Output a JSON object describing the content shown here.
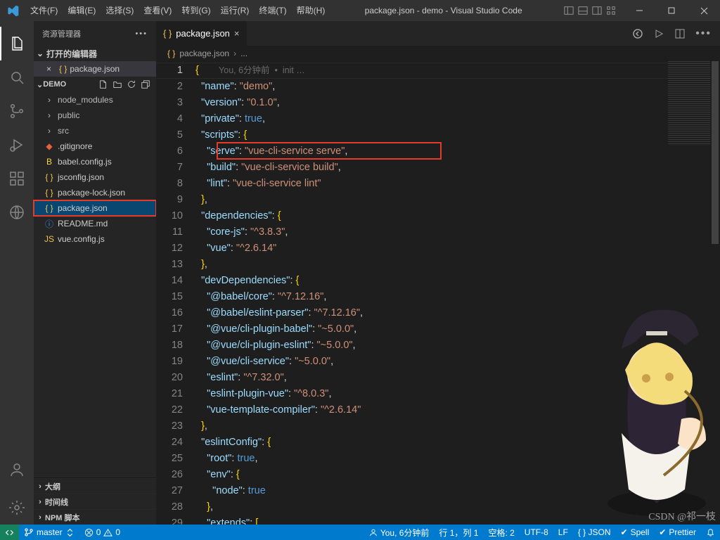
{
  "menu": [
    "文件(F)",
    "编辑(E)",
    "选择(S)",
    "查看(V)",
    "转到(G)",
    "运行(R)",
    "终端(T)",
    "帮助(H)"
  ],
  "window_title": "package.json - demo - Visual Studio Code",
  "sidebar": {
    "header": "资源管理器",
    "open_editors": {
      "label": "打开的编辑器",
      "file": "package.json"
    },
    "demo_label": "DEMO",
    "tree": [
      {
        "kind": "folder",
        "name": "node_modules"
      },
      {
        "kind": "folder",
        "name": "public"
      },
      {
        "kind": "folder",
        "name": "src"
      },
      {
        "kind": "file",
        "icon": "git",
        "name": ".gitignore"
      },
      {
        "kind": "file",
        "icon": "babel",
        "name": "babel.config.js"
      },
      {
        "kind": "file",
        "icon": "json",
        "name": "jsconfig.json"
      },
      {
        "kind": "file",
        "icon": "json",
        "name": "package-lock.json"
      },
      {
        "kind": "file",
        "icon": "json",
        "name": "package.json",
        "selected": true
      },
      {
        "kind": "file",
        "icon": "info",
        "name": "README.md"
      },
      {
        "kind": "file",
        "icon": "js",
        "name": "vue.config.js"
      }
    ],
    "collapsed": [
      "大纲",
      "时间线",
      "NPM 脚本"
    ]
  },
  "tab": {
    "name": "package.json"
  },
  "breadcrumb": [
    "package.json",
    "..."
  ],
  "code_lens": {
    "author": "You,",
    "time": "6分钟前",
    "sep": "•",
    "msg": "init …"
  },
  "code_lines": [
    {
      "n": 1
    },
    {
      "n": 2,
      "key": "name",
      "val": "demo",
      "t": "s",
      "comma": true
    },
    {
      "n": 3,
      "key": "version",
      "val": "0.1.0",
      "t": "s",
      "comma": true
    },
    {
      "n": 4,
      "key": "private",
      "val": "true",
      "t": "b",
      "comma": true
    },
    {
      "n": 5,
      "key": "scripts",
      "open": true
    },
    {
      "n": 6,
      "key": "serve",
      "val": "vue-cli-service serve",
      "t": "s",
      "comma": true,
      "ind": 2,
      "hl": true
    },
    {
      "n": 7,
      "key": "build",
      "val": "vue-cli-service build",
      "t": "s",
      "comma": true,
      "ind": 2
    },
    {
      "n": 8,
      "key": "lint",
      "val": "vue-cli-service lint",
      "t": "s",
      "ind": 2
    },
    {
      "n": 9,
      "close": true,
      "comma": true
    },
    {
      "n": 10,
      "key": "dependencies",
      "open": true
    },
    {
      "n": 11,
      "key": "core-js",
      "val": "^3.8.3",
      "t": "s",
      "comma": true,
      "ind": 2
    },
    {
      "n": 12,
      "key": "vue",
      "val": "^2.6.14",
      "t": "s",
      "ind": 2
    },
    {
      "n": 13,
      "close": true,
      "comma": true
    },
    {
      "n": 14,
      "key": "devDependencies",
      "open": true
    },
    {
      "n": 15,
      "key": "@babel/core",
      "val": "^7.12.16",
      "t": "s",
      "comma": true,
      "ind": 2
    },
    {
      "n": 16,
      "key": "@babel/eslint-parser",
      "val": "^7.12.16",
      "t": "s",
      "comma": true,
      "ind": 2
    },
    {
      "n": 17,
      "key": "@vue/cli-plugin-babel",
      "val": "~5.0.0",
      "t": "s",
      "comma": true,
      "ind": 2
    },
    {
      "n": 18,
      "key": "@vue/cli-plugin-eslint",
      "val": "~5.0.0",
      "t": "s",
      "comma": true,
      "ind": 2
    },
    {
      "n": 19,
      "key": "@vue/cli-service",
      "val": "~5.0.0",
      "t": "s",
      "comma": true,
      "ind": 2
    },
    {
      "n": 20,
      "key": "eslint",
      "val": "^7.32.0",
      "t": "s",
      "comma": true,
      "ind": 2
    },
    {
      "n": 21,
      "key": "eslint-plugin-vue",
      "val": "^8.0.3",
      "t": "s",
      "comma": true,
      "ind": 2
    },
    {
      "n": 22,
      "key": "vue-template-compiler",
      "val": "^2.6.14",
      "t": "s",
      "ind": 2
    },
    {
      "n": 23,
      "close": true,
      "comma": true
    },
    {
      "n": 24,
      "key": "eslintConfig",
      "open": true
    },
    {
      "n": 25,
      "key": "root",
      "val": "true",
      "t": "b",
      "comma": true,
      "ind": 2
    },
    {
      "n": 26,
      "key": "env",
      "open": true,
      "ind": 2
    },
    {
      "n": 27,
      "key": "node",
      "val": "true",
      "t": "b",
      "ind": 3
    },
    {
      "n": 28,
      "close": true,
      "comma": true,
      "ind": 2
    },
    {
      "n": 29,
      "key": "extends",
      "arr": true,
      "ind": 2
    }
  ],
  "status": {
    "branch": "master",
    "sync": "",
    "errors": "0",
    "warnings": "0",
    "blame": "You, 6分钟前",
    "pos": "行 1，列 1",
    "spaces": "空格: 2",
    "enc": "UTF-8",
    "eol": "LF",
    "lang": "{ } JSON",
    "spell": "Spell",
    "prettier": "Prettier",
    "bell": ""
  },
  "watermark": "CSDN @祁一枝"
}
